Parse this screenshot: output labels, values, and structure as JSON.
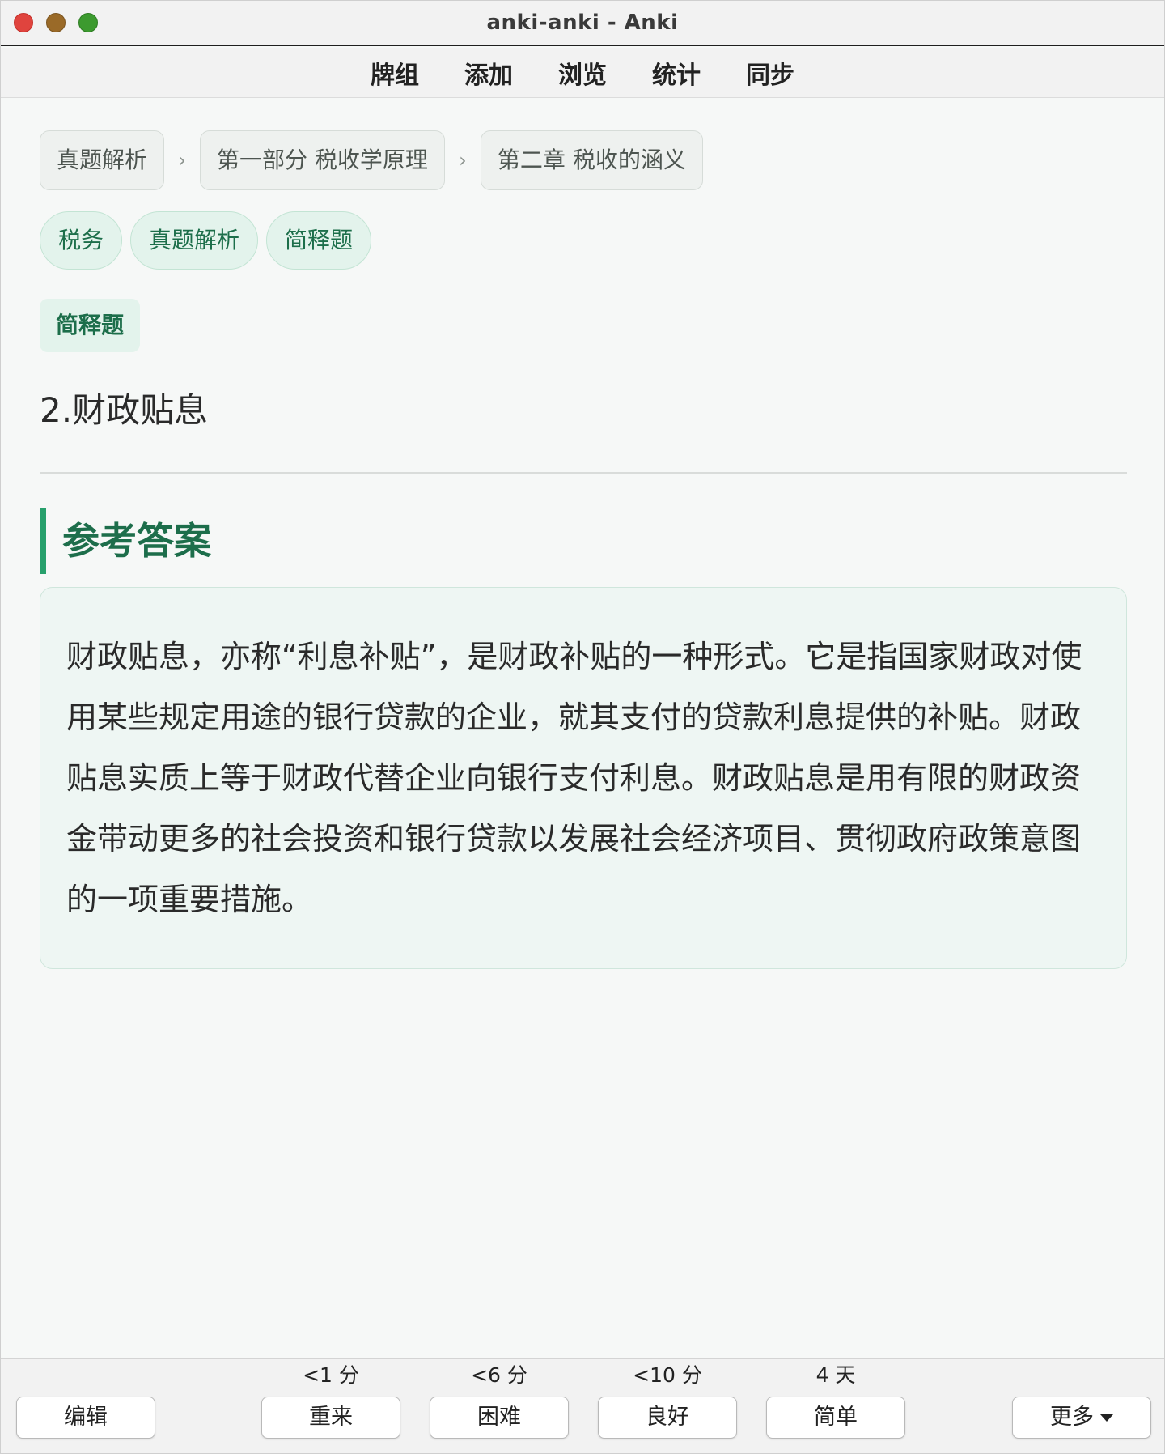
{
  "window": {
    "title": "anki-anki - Anki"
  },
  "toolbar": {
    "items": [
      {
        "label": "牌组"
      },
      {
        "label": "添加"
      },
      {
        "label": "浏览"
      },
      {
        "label": "统计"
      },
      {
        "label": "同步"
      }
    ]
  },
  "breadcrumb": {
    "items": [
      "真题解析",
      "第一部分 税收学原理",
      "第二章 税收的涵义"
    ],
    "separator": "›"
  },
  "tags": [
    "税务",
    "真题解析",
    "简释题"
  ],
  "card": {
    "type_label": "简释题",
    "question": "2.财政贴息",
    "answer_heading": "参考答案",
    "answer": "财政贴息，亦称“利息补贴”，是财政补贴的一种形式。它是指国家财政对使用某些规定用途的银行贷款的企业，就其支付的贷款利息提供的补贴。财政贴息实质上等于财政代替企业向银行支付利息。财政贴息是用有限的财政资金带动更多的社会投资和银行贷款以发展社会经济项目、贯彻政府政策意图的一项重要措施。"
  },
  "bottombar": {
    "edit_label": "编辑",
    "more_label": "更多",
    "ease_buttons": [
      {
        "time": "<1 分",
        "label": "重来"
      },
      {
        "time": "<6 分",
        "label": "困难"
      },
      {
        "time": "<10 分",
        "label": "良好"
      },
      {
        "time": "4 天",
        "label": "简单"
      }
    ]
  },
  "colors": {
    "accent_green": "#27a06c",
    "heading_green": "#1d6e4b",
    "tag_background": "#e3f3ec",
    "answer_background": "#eef6f3"
  }
}
